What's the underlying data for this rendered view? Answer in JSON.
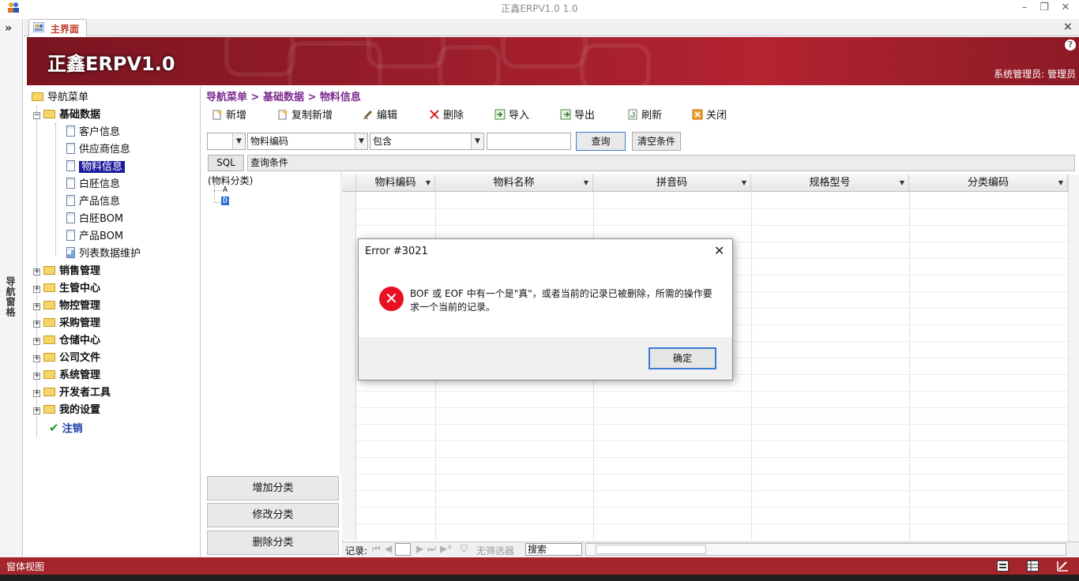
{
  "window": {
    "title": "正鑫ERPV1.0 1.0"
  },
  "navpane": {
    "toggle": "»",
    "label": "导航窗格"
  },
  "tabs": {
    "main_label": "主界面",
    "close": "×"
  },
  "banner": {
    "title": "正鑫ERPV1.0",
    "user": "系统管理员: 管理员",
    "help": "?"
  },
  "nav_tree": {
    "root": "导航菜单",
    "items": [
      {
        "label": "基础数据",
        "expanded": true
      },
      {
        "label": "客户信息"
      },
      {
        "label": "供应商信息"
      },
      {
        "label": "物料信息",
        "selected": true
      },
      {
        "label": "白胚信息"
      },
      {
        "label": "产品信息"
      },
      {
        "label": "白胚BOM"
      },
      {
        "label": "产品BOM"
      },
      {
        "label": "列表数据维护"
      },
      {
        "label": "销售管理"
      },
      {
        "label": "生管中心"
      },
      {
        "label": "物控管理"
      },
      {
        "label": "采购管理"
      },
      {
        "label": "仓储中心"
      },
      {
        "label": "公司文件"
      },
      {
        "label": "系统管理"
      },
      {
        "label": "开发者工具"
      },
      {
        "label": "我的设置"
      },
      {
        "label": "注销"
      }
    ]
  },
  "breadcrumb": "导航菜单 > 基础数据 > 物料信息",
  "toolbar": {
    "new": "新增",
    "copy_new": "复制新增",
    "edit": "编辑",
    "delete": "删除",
    "import": "导入",
    "export": "导出",
    "refresh": "刷新",
    "close": "关闭"
  },
  "filter": {
    "field1_value": "",
    "field_value": "物料编码",
    "operator_value": "包含",
    "search_value": "",
    "query_button": "查询",
    "clear_button": "清空条件"
  },
  "sql": {
    "button": "SQL",
    "text": "查询条件"
  },
  "category": {
    "root": "(物料分类)",
    "nodes": [
      "A",
      "D"
    ],
    "add": "增加分类",
    "edit": "修改分类",
    "delete": "删除分类"
  },
  "grid": {
    "columns": [
      "物料编码",
      "物料名称",
      "拼音码",
      "规格型号",
      "分类编码"
    ]
  },
  "recnav": {
    "label": "记录:",
    "no_filter": "无筛选器",
    "search": "搜索"
  },
  "statusbar": {
    "label": "窗体视图"
  },
  "dialog": {
    "title": "Error #3021",
    "message": "BOF 或 EOF 中有一个是\"真\"，或者当前的记录已被删除，所需的操作要求一个当前的记录。",
    "ok": "确定"
  }
}
